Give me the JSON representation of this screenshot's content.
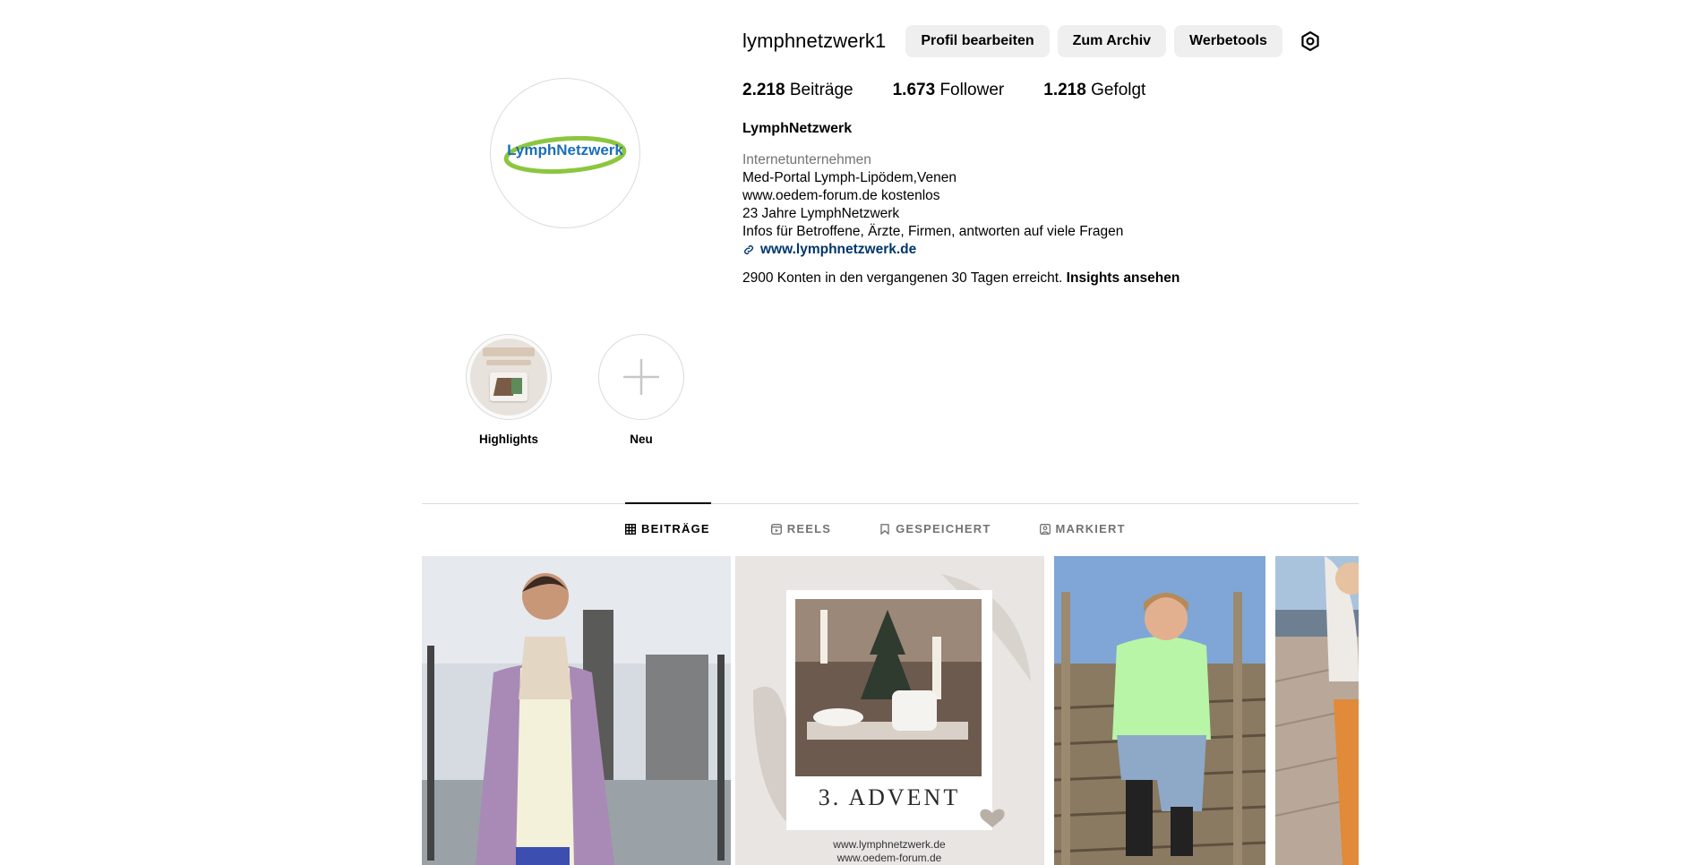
{
  "profile": {
    "username": "lymphnetzwerk1",
    "logo_text": "LymphNetzwerk",
    "buttons": {
      "edit": "Profil bearbeiten",
      "archive": "Zum Archiv",
      "ad_tools": "Werbetools"
    },
    "settings_icon": "gear-icon",
    "stats": {
      "posts_count": "2.218",
      "posts_label": "Beiträge",
      "followers_count": "1.673",
      "followers_label": "Follower",
      "following_count": "1.218",
      "following_label": "Gefolgt"
    },
    "full_name": "LymphNetzwerk",
    "category": "Internetunternehmen",
    "bio_lines": [
      "Med-Portal Lymph-Lipödem,Venen",
      "www.oedem-forum.de kostenlos",
      "23 Jahre LymphNetzwerk",
      "Infos für Betroffene, Ärzte, Firmen, antworten auf viele Fragen"
    ],
    "link": "www.lymphnetzwerk.de",
    "insights_text": "2900 Konten in den vergangenen 30 Tagen erreicht.",
    "insights_link": "Insights ansehen"
  },
  "highlights": [
    {
      "label": "Highlights"
    },
    {
      "label": "Neu"
    }
  ],
  "tabs": [
    {
      "label": "BEITRÄGE",
      "icon": "grid-icon",
      "active": true
    },
    {
      "label": "REELS",
      "icon": "reels-icon",
      "active": false
    },
    {
      "label": "GESPEICHERT",
      "icon": "bookmark-icon",
      "active": false
    },
    {
      "label": "MARKIERT",
      "icon": "tagged-icon",
      "active": false
    }
  ],
  "posts": [
    {
      "type": "photo"
    },
    {
      "type": "advent-card",
      "title": "3. ADVENT",
      "line1": "www.lymphnetzwerk.de",
      "line2": "www.oedem-forum.de"
    },
    {
      "type": "photo"
    },
    {
      "type": "photo"
    }
  ],
  "colors": {
    "button_bg": "#efefef",
    "link": "#00376b",
    "muted": "#737373",
    "logo_blue": "#1b6fb8",
    "logo_green": "#8cc63f"
  }
}
